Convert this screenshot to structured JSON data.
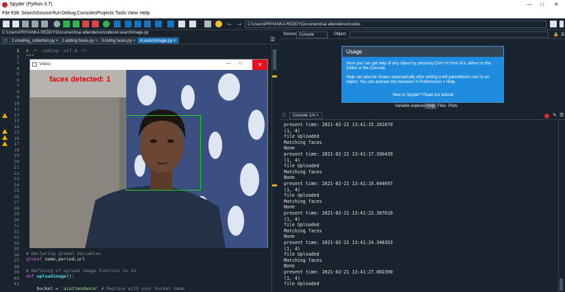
{
  "app": {
    "title": "Spyder (Python 3.7)"
  },
  "menu": [
    "File",
    "Edit",
    "Search",
    "Source",
    "Run",
    "Debug",
    "Consoles",
    "Projects",
    "Tools",
    "View",
    "Help"
  ],
  "toolbar": {
    "path": "C:\\Users\\PRIYANKA REDDY\\Documents\\ai attendence\\codes"
  },
  "editor": {
    "filepath": "C:\\Users\\PRIYANKA REDDY\\Documents\\ai attendence\\codes\\4.searchimage.py",
    "tabs": [
      "1.creating_collection.py",
      "2.adding faces.py",
      "3.listing faces.py",
      "4.searchimage.py"
    ],
    "line_numbers": [
      "1",
      "2",
      "3",
      "4",
      "5",
      "6",
      "7",
      "8",
      "9",
      "10",
      "11",
      "12",
      "13",
      "14",
      "15",
      "16",
      "17",
      "18",
      "19",
      "20",
      "21",
      "22",
      "23",
      "24",
      "25",
      "26",
      "27",
      "28",
      "29",
      "30",
      "31",
      "32",
      "33",
      "34",
      "35",
      "36",
      "37",
      "38",
      "39",
      "40",
      "41"
    ],
    "line1": "# -*- coding: utf-8 -*-",
    "line2": "\"\"\"",
    "line35": "# Declaring global Variables",
    "line36_kw": "global",
    "line36_rest": " name,period,url",
    "line38": "# Defining of upload image function to S3",
    "line39_kw": "def",
    "line39_fn": "uploadimage",
    "line39_rest": "():",
    "line41_pre": "    bucket = ",
    "line41_str": "'aiattendance'",
    "line41_cmt": " # Replace with your bucket name"
  },
  "video": {
    "title": "Video",
    "label": "faces detected: 1"
  },
  "help": {
    "tabs": [
      "Source",
      "Console",
      "Object"
    ],
    "usage_title": "Usage",
    "usage_p1": "Here you can get help of any object by pressing Ctrl+I in front of it, either on the Editor or the Console.",
    "usage_p2": "Help can also be shown automatically after writing a left parenthesis next to an object. You can activate this behavior in Preferences > Help.",
    "usage_p3": "New to Spyder? Read our tutorial",
    "pane_buttons": [
      "Variable explorer",
      "Help",
      "Files",
      "Plots"
    ]
  },
  "console": {
    "tab": "Console 1/A",
    "lines": [
      "present time: 2021-02-21 13:41:15.201670",
      "(1, 4)",
      "file Uploaded",
      "Matching faces",
      "None",
      "present time: 2021-02-21 13:41:17.390439",
      "(1, 4)",
      "file Uploaded",
      "Matching faces",
      "None",
      "present time: 2021-02-21 13:41:19.644697",
      "(1, 4)",
      "file Uploaded",
      "Matching faces",
      "None",
      "present time: 2021-02-21 13:41:22.307610",
      "(1, 4)",
      "file Uploaded",
      "Matching faces",
      "None",
      "present time: 2021-02-21 13:41:24.348393",
      "(1, 4)",
      "file Uploaded",
      "Matching faces",
      "None",
      "present time: 2021-02-21 13:41:27.002390",
      "(1, 4)",
      "file Uploaded"
    ]
  }
}
